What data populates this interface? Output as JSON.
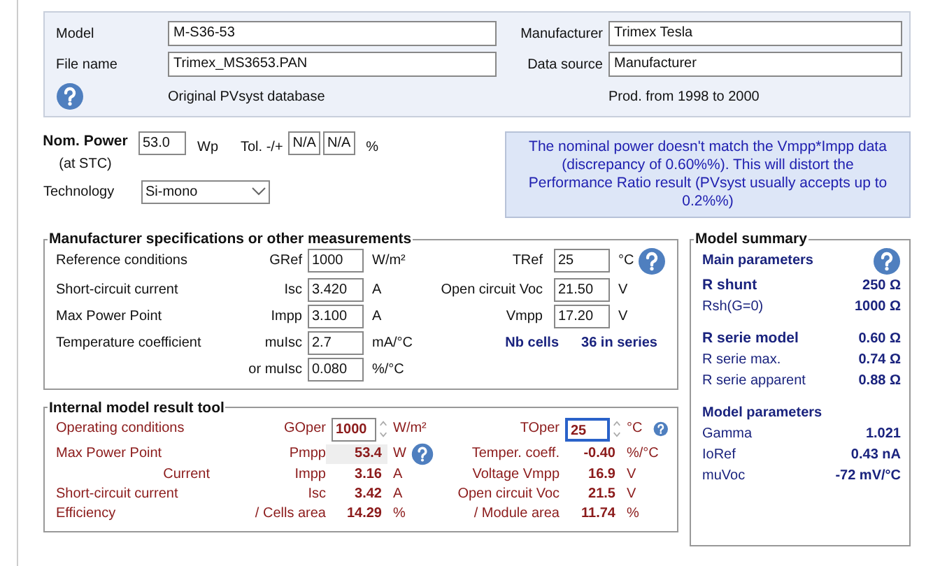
{
  "header": {
    "fields": [
      {
        "label": "Model",
        "value": "M-S36-53"
      },
      {
        "label": "Manufacturer",
        "value": "Trimex Tesla"
      },
      {
        "label": "File name",
        "value": "Trimex_MS3653.PAN"
      },
      {
        "label": "Data source",
        "value": "Manufacturer"
      }
    ],
    "notes": [
      "Original PVsyst database",
      "Prod. from 1998 to 2000"
    ]
  },
  "nominal": {
    "label": "Nom. Power",
    "sublabel": "(at STC)",
    "value": "53.0",
    "unit": "Wp",
    "tol_label": "Tol. -/+",
    "tol_minus": "N/A",
    "tol_plus": "N/A",
    "tol_unit": "%",
    "technology_label": "Technology",
    "technology": "Si-mono"
  },
  "warning": "The nominal power doesn't match the Vmpp*Impp data (discrepancy of 0.60%%). This will distort the Performance Ratio result (PVsyst usually accepts up to 0.2%%)",
  "specs": {
    "title": "Manufacturer specifications or other measurements",
    "left_rows": [
      {
        "label": "Reference conditions",
        "param": "GRef",
        "value": "1000",
        "unit": "W/m²"
      },
      {
        "label": "Short-circuit current",
        "param": "Isc",
        "value": "3.420",
        "unit": "A"
      },
      {
        "label": "Max Power Point",
        "param": "Impp",
        "value": "3.100",
        "unit": "A"
      },
      {
        "label": "Temperature coefficient",
        "param": "muIsc",
        "value": "2.7",
        "unit": "mA/°C"
      },
      {
        "param": "or  muIsc",
        "value": "0.080",
        "unit": "%/°C"
      }
    ],
    "right_rows": [
      {
        "param": "TRef",
        "value": "25",
        "unit": "°C"
      },
      {
        "param": "Open circuit Voc",
        "value": "21.50",
        "unit": "V"
      },
      {
        "param": "Vmpp",
        "value": "17.20",
        "unit": "V"
      }
    ],
    "cells_label": "Nb cells",
    "cells_value": "36 in series"
  },
  "tool": {
    "title": "Internal model result tool",
    "operating": {
      "label": "Operating conditions",
      "g_param": "GOper",
      "g_value": "1000",
      "g_unit": "W/m²",
      "t_param": "TOper",
      "t_value": "25",
      "t_unit": "°C",
      "t_focused": true
    },
    "left_rows": [
      {
        "kind": "main",
        "label": "Max Power Point",
        "param": "Pmpp",
        "value": "53.4",
        "unit": "W",
        "highlighted": true
      },
      {
        "kind": "sub",
        "label": "Current",
        "param": "Impp",
        "value": "3.16",
        "unit": "A",
        "highlighted": false
      },
      {
        "kind": "main",
        "label": "Short-circuit current",
        "param": "Isc",
        "value": "3.42",
        "unit": "A",
        "highlighted": false
      },
      {
        "kind": "main",
        "label": "Efficiency",
        "param": "/ Cells area",
        "value": "14.29",
        "unit": "%",
        "highlighted": false
      }
    ],
    "right_rows": [
      {
        "label": "Temper. coeff.",
        "value": "-0.40",
        "unit": "%/°C"
      },
      {
        "label": "Voltage Vmpp",
        "value": "16.9",
        "unit": "V"
      },
      {
        "label": "Open circuit Voc",
        "value": "21.5",
        "unit": "V"
      },
      {
        "label": "/ Module area",
        "value": "11.74",
        "unit": "%"
      }
    ]
  },
  "summary": {
    "title": "Model summary",
    "groups": [
      {
        "heading": "Main parameters",
        "rows": [
          {
            "kind": "primary",
            "label": "R shunt",
            "value": "250 Ω"
          },
          {
            "kind": "secondary",
            "label": "Rsh(G=0)",
            "value": "1000 Ω"
          }
        ]
      },
      {
        "rows": [
          {
            "kind": "primary",
            "label": "R serie model",
            "value": "0.60 Ω"
          },
          {
            "kind": "secondary",
            "label": "R serie max.",
            "value": "0.74 Ω"
          },
          {
            "kind": "secondary",
            "label": "R serie apparent",
            "value": "0.88 Ω"
          }
        ]
      },
      {
        "heading": "Model parameters",
        "rows": [
          {
            "kind": "secondary",
            "label": "Gamma",
            "value": "1.021"
          },
          {
            "kind": "secondary",
            "label": "IoRef",
            "value": "0.43 nA"
          },
          {
            "kind": "secondary",
            "label": "muVoc",
            "value": "-72 mV/°C"
          }
        ]
      }
    ]
  }
}
